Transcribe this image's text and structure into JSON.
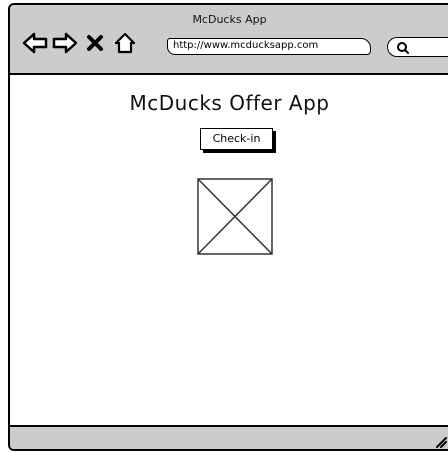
{
  "window": {
    "title": "McDucks App"
  },
  "toolbar": {
    "back_icon": "arrow-left-icon",
    "forward_icon": "arrow-right-icon",
    "stop_icon": "close-icon",
    "home_icon": "home-icon",
    "url": "http://www.mcducksapp.com",
    "search_icon": "search-icon"
  },
  "page": {
    "title": "McDucks Offer App",
    "checkin_label": "Check-in",
    "image_placeholder": "image-placeholder"
  },
  "colors": {
    "chrome": "#cccccc",
    "border": "#000000",
    "background": "#ffffff"
  }
}
